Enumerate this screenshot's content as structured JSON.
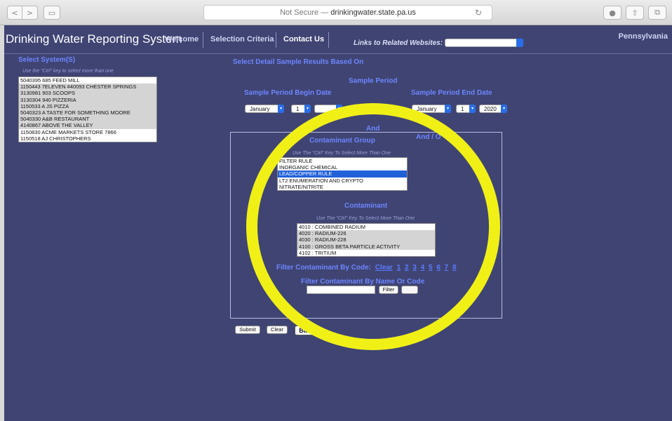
{
  "browser": {
    "url_prefix": "Not Secure — ",
    "url_host": "drinkingwater.state.pa.us"
  },
  "header": {
    "title": "Drinking Water Reporting System",
    "tabs": [
      "Welcome",
      "Selection Criteria",
      "Contact Us"
    ],
    "links_label": "Links to Related Websites:",
    "pa_text": "Pennsylvania"
  },
  "systems": {
    "title": "Select System(S)",
    "hint": "Use the \"Ctrl\" key to select more than one",
    "items": [
      {
        "label": "5040395 685 FEED MILL",
        "state": "normal"
      },
      {
        "label": "1150443 7ELEVEN #40093 CHESTER SPRINGS",
        "state": "sel"
      },
      {
        "label": "3130981 903 SCOOPS",
        "state": "sel"
      },
      {
        "label": "3130304 940 PIZZERIA",
        "state": "sel"
      },
      {
        "label": "1150533 A JS PIZZA",
        "state": "sel"
      },
      {
        "label": "5040323 A TASTE FOR SOMETHING MOORE",
        "state": "sel"
      },
      {
        "label": "5040330 A&B RESTAURANT",
        "state": "sel"
      },
      {
        "label": "4140867 ABOVE THE VALLEY",
        "state": "sel"
      },
      {
        "label": "1150830 ACME MARKETS STORE 7866",
        "state": "normal"
      },
      {
        "label": "1150518 AJ CHRISTOPHERS",
        "state": "normal"
      }
    ]
  },
  "center_title": "Select Detail Sample Results Based On",
  "sample_period": {
    "title": "Sample Period",
    "begin_title": "Sample Period Begin Date",
    "end_title": "Sample Period End Date",
    "begin_month": "January",
    "begin_day": "1",
    "end_month": "January",
    "end_day": "1",
    "end_year": "2020"
  },
  "and_text": "And",
  "and_or_text": "And / O",
  "contaminant_group": {
    "title": "Contaminant Group",
    "hint": "Use The \"Ctrl\" Key To Select More Than One",
    "items": [
      {
        "label": "FILTER RULE",
        "state": "normal"
      },
      {
        "label": "INORGANIC CHEMICAL",
        "state": "normal"
      },
      {
        "label": "LEAD/COPPER RULE",
        "state": "hl"
      },
      {
        "label": "LT2 ENUMERATION AND CRYPTO",
        "state": "normal"
      },
      {
        "label": "NITRATE/NITRITE",
        "state": "normal"
      }
    ]
  },
  "contaminant": {
    "title": "Contaminant",
    "hint": "Use The \"Ctrl\" Key To Select More Than One",
    "items": [
      {
        "label": "4010 : COMBINED RADIUM",
        "state": "normal"
      },
      {
        "label": "4020 : RADIUM-226",
        "state": "sel"
      },
      {
        "label": "4030 : RADIUM-228",
        "state": "sel"
      },
      {
        "label": "4100 : GROSS BETA PARTICLE ACTIVITY",
        "state": "sel"
      },
      {
        "label": "4102 : TRITIUM",
        "state": "normal"
      }
    ]
  },
  "filter": {
    "by_code_label": "Filter Contaminant By Code:",
    "clear_link": "Clear",
    "code_links": [
      "1",
      "2",
      "3",
      "4",
      "5",
      "6",
      "7",
      "8"
    ],
    "by_name_label": "Filter Contaminant By Name Or Code",
    "filter_button": "Filter"
  },
  "buttons": {
    "submit": "Submit",
    "clear": "Clear",
    "back": "Back"
  },
  "colors": {
    "page_bg": "#3f4473",
    "heading_blue": "#6e86ff",
    "highlight_circle": "#f0f017",
    "selected_row": "#2261d8"
  }
}
